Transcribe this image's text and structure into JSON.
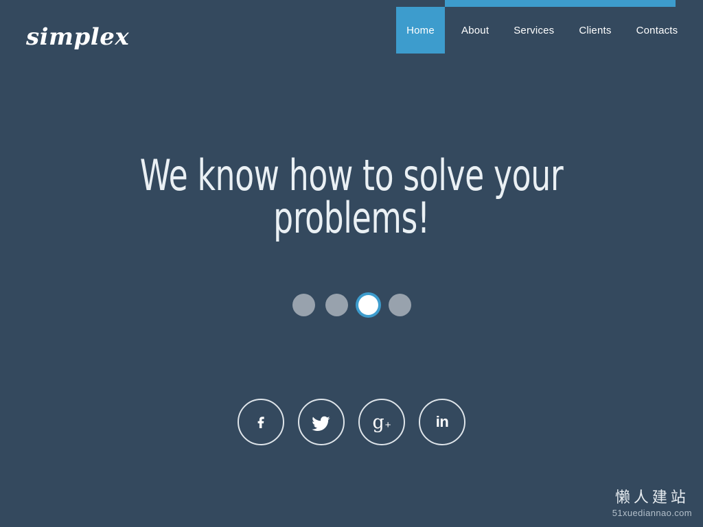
{
  "site": {
    "logo_text": "simplex",
    "background_color": "#34495e",
    "accent_color": "#3d9ccd"
  },
  "header": {
    "accent_bar": {
      "color": "#3d9ccd"
    },
    "nav": {
      "items": [
        {
          "label": "Home",
          "active": true,
          "name": "nav-item-home"
        },
        {
          "label": "About",
          "active": false,
          "name": "nav-item-about"
        },
        {
          "label": "Services",
          "active": false,
          "name": "nav-item-services"
        },
        {
          "label": "Clients",
          "active": false,
          "name": "nav-item-clients"
        },
        {
          "label": "Contacts",
          "active": false,
          "name": "nav-item-contacts"
        }
      ]
    }
  },
  "hero": {
    "title": "We know how to solve your\nproblems!",
    "title_color": "#eaf0f4"
  },
  "slider": {
    "dot_count": 4,
    "active_index": 2,
    "dot_color": "#98a2ad",
    "active_dot_color": "#ffffff",
    "active_ring_color": "#3d9ccd",
    "dots": [
      {
        "label": "Slide 1"
      },
      {
        "label": "Slide 2"
      },
      {
        "label": "Slide 3"
      },
      {
        "label": "Slide 4"
      }
    ]
  },
  "social": {
    "items": [
      {
        "icon": "facebook-icon",
        "label": "Facebook"
      },
      {
        "icon": "twitter-icon",
        "label": "Twitter"
      },
      {
        "icon": "googleplus-icon",
        "label": "Google Plus"
      },
      {
        "icon": "linkedin-icon",
        "label": "LinkedIn"
      }
    ]
  },
  "watermark": {
    "text_cn": "懒人建站",
    "url": "51xuediannao.com"
  }
}
